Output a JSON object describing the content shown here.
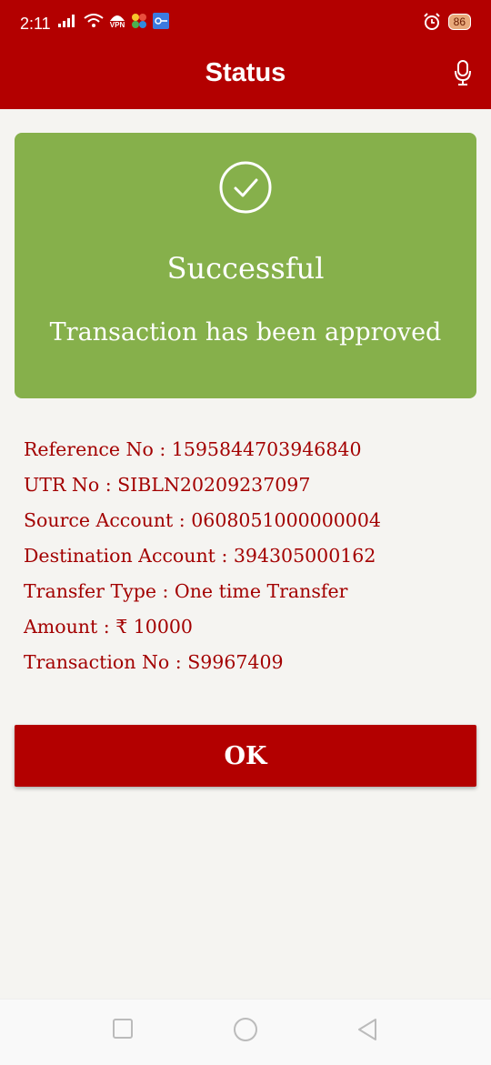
{
  "status_bar": {
    "time": "2:11",
    "vpn_label": "VPN",
    "battery": "86"
  },
  "header": {
    "title": "Status"
  },
  "result": {
    "title": "Successful",
    "message": "Transaction has been approved",
    "color": "#86b04b"
  },
  "details": [
    {
      "label": "Reference No",
      "value": "1595844703946840"
    },
    {
      "label": "UTR No",
      "value": "SIBLN20209237097"
    },
    {
      "label": "Source Account",
      "value": "0608051000000004"
    },
    {
      "label": "Destination Account",
      "value": "394305000162"
    },
    {
      "label": "Transfer Type",
      "value": "One time Transfer"
    },
    {
      "label": "Amount",
      "value": "₹ 10000"
    },
    {
      "label": "Transaction No",
      "value": "S9967409"
    }
  ],
  "actions": {
    "ok_label": "OK"
  },
  "theme": {
    "brand": "#b30000",
    "text_accent": "#a30000"
  }
}
